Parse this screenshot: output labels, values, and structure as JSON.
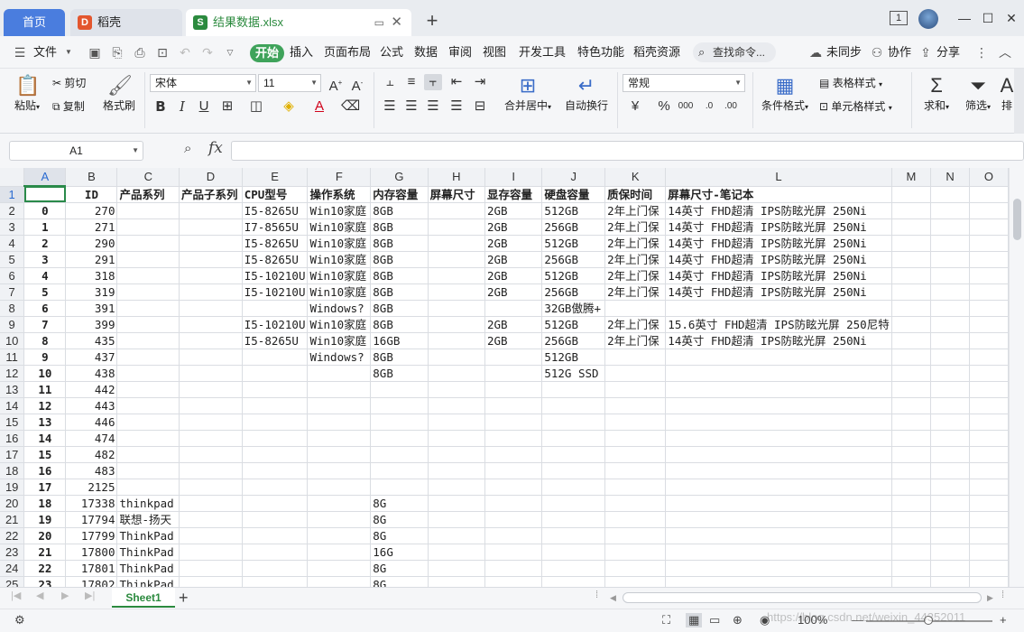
{
  "tabs": {
    "home": "首页",
    "daoke": "稻壳",
    "file": "结果数据.xlsx",
    "close": "✕",
    "add": "+"
  },
  "window": {
    "badge": "1",
    "minimize": "—",
    "restore": "☐",
    "close": "✕"
  },
  "menu": {
    "file": "文件",
    "start": "开始",
    "items": [
      "插入",
      "页面布局",
      "公式",
      "数据",
      "审阅",
      "视图",
      "开发工具",
      "特色功能",
      "稻壳资源"
    ],
    "search": "查找命令...",
    "unsync": "未同步",
    "collab": "协作",
    "share": "分享"
  },
  "ribbon": {
    "paste": "粘贴",
    "cut": "剪切",
    "copy": "复制",
    "format_painter": "格式刷",
    "font_name": "宋体",
    "font_size": "11",
    "number_format": "常规",
    "merge_center": "合并居中",
    "wrap_text": "自动换行",
    "cond_format": "条件格式",
    "table_style": "表格样式",
    "cell_style": "单元格样式",
    "sum": "求和",
    "filter": "筛选",
    "sort": "排"
  },
  "formula": {
    "cell_ref": "A1",
    "fx": "fx",
    "value": ""
  },
  "columns": [
    "A",
    "B",
    "C",
    "D",
    "E",
    "F",
    "G",
    "H",
    "I",
    "J",
    "K",
    "L",
    "M",
    "N",
    "O"
  ],
  "rows": [
    [
      "",
      "ID",
      "产品系列",
      "产品子系列",
      "CPU型号",
      "操作系统",
      "内存容量",
      "屏幕尺寸",
      "显存容量",
      "硬盘容量",
      "质保时间",
      "屏幕尺寸-笔记本",
      "",
      "",
      ""
    ],
    [
      "0",
      "270",
      "",
      "",
      "I5-8265U",
      "Win10家庭",
      "8GB",
      "",
      "2GB",
      "512GB",
      "2年上门保",
      "14英寸 FHD超清 IPS防眩光屏 250Ni",
      "",
      "",
      ""
    ],
    [
      "1",
      "271",
      "",
      "",
      "I7-8565U",
      "Win10家庭",
      "8GB",
      "",
      "2GB",
      "256GB",
      "2年上门保",
      "14英寸 FHD超清 IPS防眩光屏 250Ni",
      "",
      "",
      ""
    ],
    [
      "2",
      "290",
      "",
      "",
      "I5-8265U",
      "Win10家庭",
      "8GB",
      "",
      "2GB",
      "512GB",
      "2年上门保",
      "14英寸 FHD超清 IPS防眩光屏 250Ni",
      "",
      "",
      ""
    ],
    [
      "3",
      "291",
      "",
      "",
      "I5-8265U",
      "Win10家庭",
      "8GB",
      "",
      "2GB",
      "256GB",
      "2年上门保",
      "14英寸 FHD超清 IPS防眩光屏 250Ni",
      "",
      "",
      ""
    ],
    [
      "4",
      "318",
      "",
      "",
      "I5-10210U",
      "Win10家庭",
      "8GB",
      "",
      "2GB",
      "512GB",
      "2年上门保",
      "14英寸 FHD超清 IPS防眩光屏 250Ni",
      "",
      "",
      ""
    ],
    [
      "5",
      "319",
      "",
      "",
      "I5-10210U",
      "Win10家庭",
      "8GB",
      "",
      "2GB",
      "256GB",
      "2年上门保",
      "14英寸 FHD超清 IPS防眩光屏 250Ni",
      "",
      "",
      ""
    ],
    [
      "6",
      "391",
      "",
      "",
      "",
      "Windows?",
      "8GB",
      "",
      "",
      "32GB傲腾+",
      "",
      "",
      "",
      "",
      ""
    ],
    [
      "7",
      "399",
      "",
      "",
      "I5-10210U",
      "Win10家庭",
      "8GB",
      "",
      "2GB",
      "512GB",
      "2年上门保",
      "15.6英寸 FHD超清 IPS防眩光屏 250尼特",
      "",
      "",
      ""
    ],
    [
      "8",
      "435",
      "",
      "",
      "I5-8265U",
      "Win10家庭",
      "16GB",
      "",
      "2GB",
      "256GB",
      "2年上门保",
      "14英寸 FHD超清 IPS防眩光屏 250Ni",
      "",
      "",
      ""
    ],
    [
      "9",
      "437",
      "",
      "",
      "",
      "Windows?",
      "8GB",
      "",
      "",
      "512GB",
      "",
      "",
      "",
      "",
      ""
    ],
    [
      "10",
      "438",
      "",
      "",
      "",
      "",
      "8GB",
      "",
      "",
      "512G SSD",
      "",
      "",
      "",
      "",
      ""
    ],
    [
      "11",
      "442",
      "",
      "",
      "",
      "",
      "",
      "",
      "",
      "",
      "",
      "",
      "",
      "",
      ""
    ],
    [
      "12",
      "443",
      "",
      "",
      "",
      "",
      "",
      "",
      "",
      "",
      "",
      "",
      "",
      "",
      ""
    ],
    [
      "13",
      "446",
      "",
      "",
      "",
      "",
      "",
      "",
      "",
      "",
      "",
      "",
      "",
      "",
      ""
    ],
    [
      "14",
      "474",
      "",
      "",
      "",
      "",
      "",
      "",
      "",
      "",
      "",
      "",
      "",
      "",
      ""
    ],
    [
      "15",
      "482",
      "",
      "",
      "",
      "",
      "",
      "",
      "",
      "",
      "",
      "",
      "",
      "",
      ""
    ],
    [
      "16",
      "483",
      "",
      "",
      "",
      "",
      "",
      "",
      "",
      "",
      "",
      "",
      "",
      "",
      ""
    ],
    [
      "17",
      "2125",
      "",
      "",
      "",
      "",
      "",
      "",
      "",
      "",
      "",
      "",
      "",
      "",
      ""
    ],
    [
      "18",
      "17338",
      "thinkpad",
      "",
      "",
      "",
      "8G",
      "",
      "",
      "",
      "",
      "",
      "",
      "",
      ""
    ],
    [
      "19",
      "17794",
      "联想-扬天",
      "",
      "",
      "",
      "8G",
      "",
      "",
      "",
      "",
      "",
      "",
      "",
      ""
    ],
    [
      "20",
      "17799",
      "ThinkPad",
      "",
      "",
      "",
      "8G",
      "",
      "",
      "",
      "",
      "",
      "",
      "",
      ""
    ],
    [
      "21",
      "17800",
      "ThinkPad",
      "",
      "",
      "",
      "16G",
      "",
      "",
      "",
      "",
      "",
      "",
      "",
      ""
    ],
    [
      "22",
      "17801",
      "ThinkPad",
      "",
      "",
      "",
      "8G",
      "",
      "",
      "",
      "",
      "",
      "",
      "",
      ""
    ],
    [
      "23",
      "17802",
      "ThinkPad",
      "",
      "",
      "",
      "8G",
      "",
      "",
      "",
      "",
      "",
      "",
      "",
      ""
    ]
  ],
  "sheet": {
    "name": "Sheet1",
    "add": "+"
  },
  "status": {
    "zoom": "100%",
    "watermark": "https://blog.csdn.net/weixin_44352011"
  },
  "colors": {
    "accent_green": "#2b8a3e",
    "home_tab_blue": "#4a7dde",
    "start_button": "#3fa35b"
  }
}
